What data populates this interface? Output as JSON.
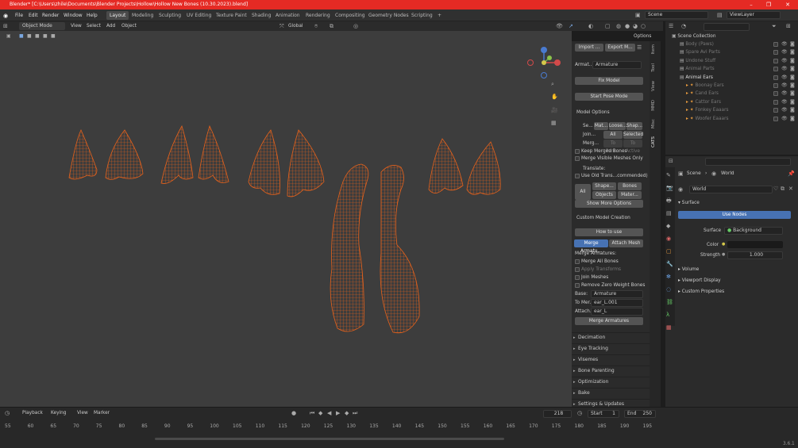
{
  "window": {
    "title": "Blender* [C:\\Users\\zhile\\Documents\\Blender Projects\\Hollow\\Hollow New Bones (10.30.2023).blend]"
  },
  "menus": [
    "File",
    "Edit",
    "Render",
    "Window",
    "Help"
  ],
  "workspaces": [
    "Layout",
    "Modeling",
    "Sculpting",
    "UV Editing",
    "Texture Paint",
    "Shading",
    "Animation",
    "Rendering",
    "Compositing",
    "Geometry Nodes",
    "Scripting"
  ],
  "active_workspace": "Layout",
  "scene_name": "Scene",
  "view_layer": "ViewLayer",
  "viewport_header": {
    "mode": "Object Mode",
    "menu": [
      "View",
      "Select",
      "Add",
      "Object"
    ],
    "orientation": "Global",
    "options_label": "Options"
  },
  "cats_panel": {
    "import_label": "Import ...",
    "export_label": "Export M...",
    "armature_label": "Armat...",
    "armature_value": "Armature",
    "fix_model": "Fix Model",
    "start_pose": "Start Pose Mode",
    "model_options": "Model Options",
    "row_sel": "Se...",
    "mat": "Mat...",
    "loose": "Loose...",
    "shap": "Shap...",
    "join": "Join...",
    "all": "All",
    "selected": "Selected",
    "merg": "Merg...",
    "to_pare": "To Pare...",
    "to_active": "To Active",
    "keep_merged": "Keep Merged Bones",
    "merge_visible": "Merge Visible Meshes Only",
    "translate": "Translate:",
    "use_old": "Use Old Trans...commended)",
    "all2": "All",
    "shape": "Shape...",
    "bones": "Bones",
    "objects": "Objects",
    "mater": "Mater...",
    "show_more": "Show More Options",
    "custom_model": "Custom Model Creation",
    "how_to": "How to use",
    "merge_arm_tab": "Merge Armatu...",
    "attach_mesh": "Attach Mesh",
    "merge_armatures_hdr": "Merge Armatures:",
    "merge_all_bones": "Merge All Bones",
    "apply_transforms": "Apply Transforms",
    "join_meshes": "Join Meshes",
    "remove_zero": "Remove Zero Weight Bones",
    "base_label": "Base:",
    "base_value": "Armature",
    "to_merge_label": "To Mer...",
    "to_merge_value": "ear_L.001",
    "attach_label": "Attach...",
    "attach_value": "ear_L",
    "merge_button": "Merge Armatures",
    "sections": [
      "Decimation",
      "Eye Tracking",
      "Visemes",
      "Bone Parenting",
      "Optimization",
      "Bake",
      "Settings & Updates"
    ]
  },
  "vertical_tabs": [
    "Item",
    "Tool",
    "View",
    "MMD",
    "Misc",
    "CATS"
  ],
  "outliner": {
    "root": "Scene Collection",
    "items": [
      {
        "name": "Body (Paws)",
        "indent": 1,
        "dim": true
      },
      {
        "name": "Spare Avi Parts",
        "indent": 1,
        "dim": true
      },
      {
        "name": "Undone Stuff",
        "indent": 1,
        "dim": true
      },
      {
        "name": "Animal Parts",
        "indent": 1,
        "dim": true
      },
      {
        "name": "Animal Ears",
        "indent": 1,
        "dim": false
      },
      {
        "name": "Boonay Ears",
        "indent": 2,
        "dim": true
      },
      {
        "name": "Cand Ears",
        "indent": 2,
        "dim": true
      },
      {
        "name": "Cattor Ears",
        "indent": 2,
        "dim": true
      },
      {
        "name": "Fonkey Eaaars",
        "indent": 2,
        "dim": true
      },
      {
        "name": "Woofer Eaaars",
        "indent": 2,
        "dim": true
      }
    ]
  },
  "properties": {
    "breadcrumb_scene": "Scene",
    "breadcrumb_world": "World",
    "world_name": "World",
    "surface_hdr": "Surface",
    "use_nodes": "Use Nodes",
    "surface_label": "Surface",
    "surface_value": "Background",
    "color_label": "Color",
    "strength_label": "Strength",
    "strength_value": "1.000",
    "volume": "Volume",
    "viewport_display": "Viewport Display",
    "custom_props": "Custom Properties"
  },
  "timeline": {
    "menus": [
      "Playback",
      "Keying",
      "View",
      "Marker"
    ],
    "current_frame": "218",
    "start_label": "Start",
    "start_value": "1",
    "end_label": "End",
    "end_value": "250",
    "ticks": [
      "55",
      "60",
      "65",
      "70",
      "75",
      "80",
      "85",
      "90",
      "95",
      "100",
      "105",
      "110",
      "115",
      "120",
      "125",
      "130",
      "135",
      "140",
      "145",
      "150",
      "155",
      "160",
      "165",
      "170",
      "175",
      "180",
      "185",
      "190",
      "195"
    ]
  },
  "version": "3.6.1",
  "colors": {
    "wire": "#e8621b",
    "accent": "#4772b3",
    "titlebar": "#e52a24"
  }
}
